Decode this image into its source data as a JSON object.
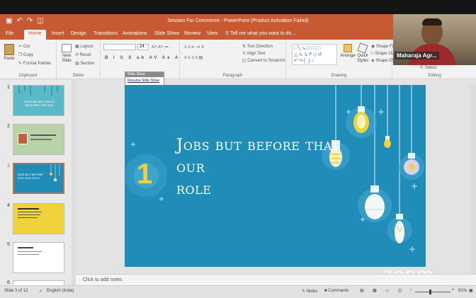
{
  "window": {
    "title": "Session For Commerce - PowerPoint (Product Activation Failed)"
  },
  "ribbon_tabs": [
    {
      "label": "File"
    },
    {
      "label": "Home"
    },
    {
      "label": "Insert"
    },
    {
      "label": "Design"
    },
    {
      "label": "Transitions"
    },
    {
      "label": "Animations"
    },
    {
      "label": "Slide Show"
    },
    {
      "label": "Review"
    },
    {
      "label": "View"
    },
    {
      "label": "Tell me what you want to do..."
    }
  ],
  "ribbon": {
    "clipboard": {
      "paste": "Paste",
      "cut": "Cut",
      "copy": "Copy",
      "format_painter": "Format Painter",
      "label": "Clipboard"
    },
    "slides": {
      "new_slide": "New Slide",
      "layout": "Layout",
      "reset": "Reset",
      "section": "Section",
      "label": "Slides"
    },
    "font": {
      "size": "24"
    },
    "paragraph": {
      "text_direction": "Text Direction",
      "align_text": "Align Text",
      "smartart": "Convert to SmartArt",
      "label": "Paragraph"
    },
    "drawing": {
      "arrange": "Arrange",
      "quick_styles": "Quick Styles",
      "shape_fill": "Shape Fill",
      "shape_outline": "Shape Outline",
      "shape_effects": "Shape Effects",
      "label": "Drawing"
    },
    "editing": {
      "select": "Select",
      "label": "Editing"
    }
  },
  "webcam": {
    "name": "Maharaja Agr..."
  },
  "slide_show_popup": {
    "title": "Slide Show",
    "resume": "Resume Slide Show"
  },
  "thumbnails": [
    {
      "num": "1",
      "title": "Working and skills required for job",
      "bg": "#5bb8c9"
    },
    {
      "num": "2",
      "title": "",
      "bg": "#b8d3a8"
    },
    {
      "num": "3",
      "title": "Jobs but before that our role",
      "bg": "#1f8db8"
    },
    {
      "num": "4",
      "title": "",
      "bg": "#f2d23a"
    },
    {
      "num": "5",
      "title": "",
      "bg": "#ffffff"
    },
    {
      "num": "6",
      "title": "",
      "bg": "#ffffff"
    }
  ],
  "slide": {
    "number": "1",
    "heading_line1": "Jobs but before that our",
    "heading_line2": "role",
    "bg_color": "#1f8db8",
    "accent_color": "#f2d23a"
  },
  "notes": {
    "placeholder": "Click to add notes"
  },
  "status": {
    "slide_info": "Slide 3 of 12",
    "language": "English (India)",
    "notes": "Notes",
    "comments": "Comments",
    "zoom": "91%"
  },
  "watermark": "zoom"
}
